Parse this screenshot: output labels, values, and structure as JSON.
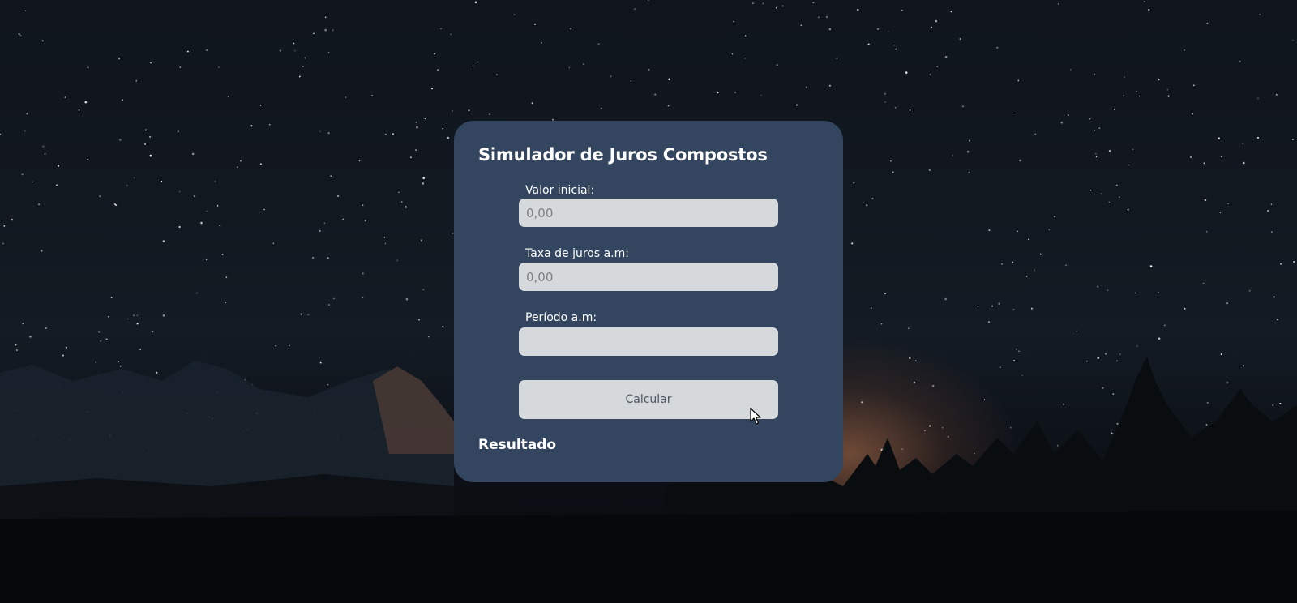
{
  "card": {
    "title": "Simulador de Juros Compostos",
    "fields": [
      {
        "label": "Valor inicial:",
        "value": "",
        "placeholder": "0,00"
      },
      {
        "label": "Taxa de juros a.m:",
        "value": "",
        "placeholder": "0,00"
      },
      {
        "label": "Período a.m:",
        "value": "",
        "placeholder": ""
      }
    ],
    "button_label": "Calcular",
    "result_title": "Resultado"
  },
  "colors": {
    "card_background": "#34465f",
    "input_background": "#d6d9dc",
    "text": "#ffffff"
  },
  "icons": [
    "mouse-cursor-icon"
  ]
}
